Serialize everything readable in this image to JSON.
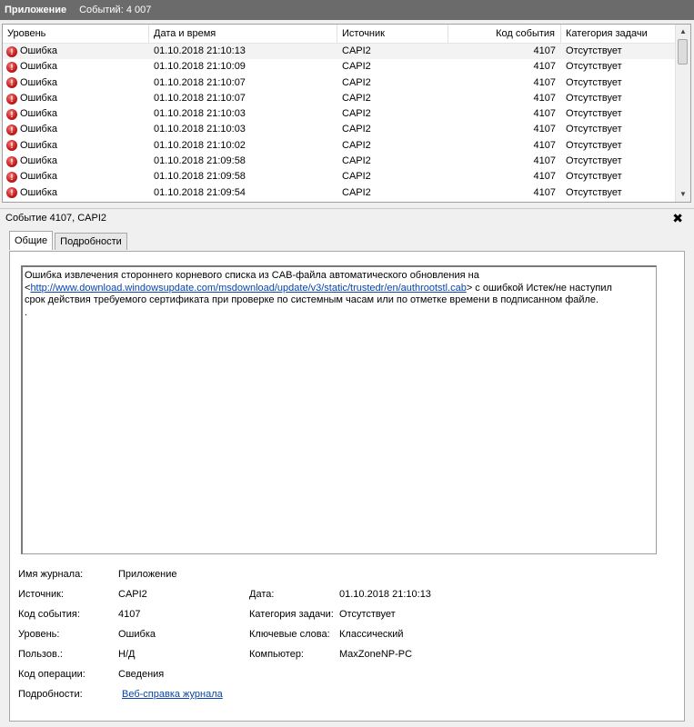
{
  "title_bar": {
    "app_name": "Приложение",
    "event_count": "Событий: 4 007"
  },
  "grid": {
    "columns": [
      "Уровень",
      "Дата и время",
      "Источник",
      "Код события",
      "Категория задачи"
    ],
    "rows": [
      {
        "level": "Ошибка",
        "date": "01.10.2018 21:10:13",
        "source": "CAPI2",
        "event_id": "4107",
        "category": "Отсутствует"
      },
      {
        "level": "Ошибка",
        "date": "01.10.2018 21:10:09",
        "source": "CAPI2",
        "event_id": "4107",
        "category": "Отсутствует"
      },
      {
        "level": "Ошибка",
        "date": "01.10.2018 21:10:07",
        "source": "CAPI2",
        "event_id": "4107",
        "category": "Отсутствует"
      },
      {
        "level": "Ошибка",
        "date": "01.10.2018 21:10:07",
        "source": "CAPI2",
        "event_id": "4107",
        "category": "Отсутствует"
      },
      {
        "level": "Ошибка",
        "date": "01.10.2018 21:10:03",
        "source": "CAPI2",
        "event_id": "4107",
        "category": "Отсутствует"
      },
      {
        "level": "Ошибка",
        "date": "01.10.2018 21:10:03",
        "source": "CAPI2",
        "event_id": "4107",
        "category": "Отсутствует"
      },
      {
        "level": "Ошибка",
        "date": "01.10.2018 21:10:02",
        "source": "CAPI2",
        "event_id": "4107",
        "category": "Отсутствует"
      },
      {
        "level": "Ошибка",
        "date": "01.10.2018 21:09:58",
        "source": "CAPI2",
        "event_id": "4107",
        "category": "Отсутствует"
      },
      {
        "level": "Ошибка",
        "date": "01.10.2018 21:09:58",
        "source": "CAPI2",
        "event_id": "4107",
        "category": "Отсутствует"
      },
      {
        "level": "Ошибка",
        "date": "01.10.2018 21:09:54",
        "source": "CAPI2",
        "event_id": "4107",
        "category": "Отсутствует"
      }
    ]
  },
  "detail": {
    "header": "Событие 4107, CAPI2",
    "close_glyph": "✖",
    "tabs": [
      {
        "label": "Общие"
      },
      {
        "label": "Подробности"
      }
    ],
    "message": {
      "line1": "Ошибка извлечения стороннего корневого списка из CAB-файла автоматического обновления на",
      "prefix": "<",
      "link": "http://www.download.windowsupdate.com/msdownload/update/v3/static/trustedr/en/authrootstl.cab",
      "suffix": "> с ошибкой Истек/не наступил",
      "line3": "срок действия требуемого сертификата при проверке по системным часам или по отметке времени в подписанном файле.",
      "line4": "."
    },
    "properties": {
      "log_name_label": "Имя журнала:",
      "log_name": "Приложение",
      "source_label": "Источник:",
      "source": "CAPI2",
      "date_label": "Дата:",
      "date": "01.10.2018 21:10:13",
      "event_id_label": "Код события:",
      "event_id": "4107",
      "category_label": "Категория задачи:",
      "category": "Отсутствует",
      "level_label": "Уровень:",
      "level": "Ошибка",
      "keywords_label": "Ключевые слова:",
      "keywords": "Классический",
      "user_label": "Пользов.:",
      "user": "Н/Д",
      "computer_label": "Компьютер:",
      "computer": "MaxZoneNP-PC",
      "opcode_label": "Код операции:",
      "opcode": "Сведения",
      "details_label": "Подробности:",
      "details_link": "Веб-справка журнала"
    }
  }
}
